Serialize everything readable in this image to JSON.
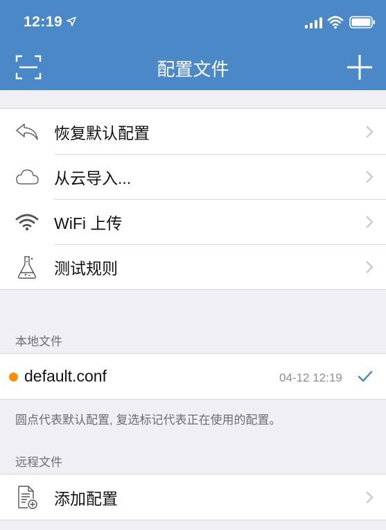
{
  "status_bar": {
    "time": "12:19"
  },
  "nav": {
    "title": "配置文件"
  },
  "actions": [
    {
      "label": "恢复默认配置",
      "icon": "undo-icon"
    },
    {
      "label": "从云导入...",
      "icon": "cloud-icon"
    },
    {
      "label": "WiFi 上传",
      "icon": "wifi-icon"
    },
    {
      "label": "测试规则",
      "icon": "flask-icon"
    }
  ],
  "local": {
    "header": "本地文件",
    "files": [
      {
        "name": "default.conf",
        "time": "04-12 12:19",
        "is_default": true,
        "in_use": true
      }
    ],
    "footer": "圆点代表默认配置, 复选标记代表正在使用的配置。"
  },
  "remote": {
    "header": "远程文件",
    "add_label": "添加配置"
  },
  "colors": {
    "nav_bg": "#4a88c7",
    "accent": "#4a88c7",
    "default_dot": "#f5900d"
  }
}
